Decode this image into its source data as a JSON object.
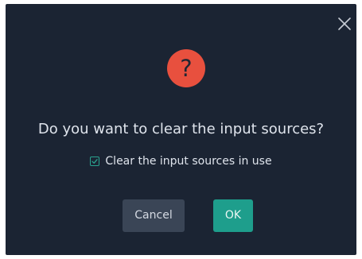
{
  "dialog": {
    "icon": "question-mark-icon",
    "icon_glyph": "?",
    "title": "Do you want to clear the input sources?",
    "checkbox": {
      "label": "Clear the input sources in use",
      "checked": true
    },
    "buttons": {
      "cancel_label": "Cancel",
      "ok_label": "OK"
    },
    "close_icon": "close-icon"
  },
  "colors": {
    "dialog_background": "#1b2433",
    "icon_background": "#e8503e",
    "accent": "#1e9e8c",
    "secondary_button": "#3a4556",
    "text": "#dfe4ec"
  }
}
